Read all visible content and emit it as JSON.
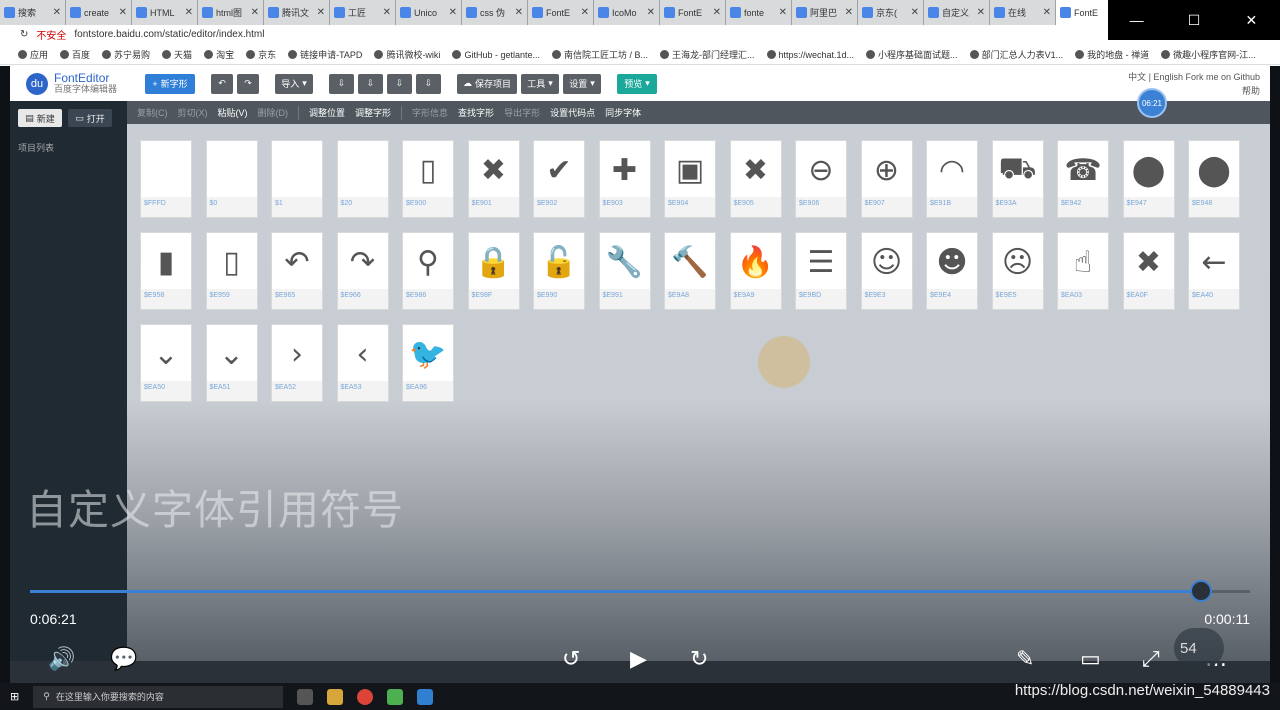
{
  "browser": {
    "tabs": [
      "搜索",
      "create",
      "HTML",
      "html图",
      "腾讯文",
      "工匠",
      "Unico",
      "css 伪",
      "FontE",
      "IcoMo",
      "FontE",
      "fonte",
      "阿里巴",
      "京东(",
      "自定义",
      "在线",
      "FontE"
    ],
    "url": "fontstore.baidu.com/static/editor/index.html",
    "insecure": "不安全",
    "bookmarks": [
      "应用",
      "百度",
      "苏宁易购",
      "天猫",
      "淘宝",
      "京东",
      "链接申请-TAPD",
      "腾讯微校-wiki",
      "GitHub - getlante...",
      "南信院工匠工坊 / B...",
      "王海龙-部门经理汇...",
      "https://wechat.1d...",
      "小程序基础面试题...",
      "部门汇总人力表V1...",
      "我的地盘 - 禅道",
      "微趣小程序官网-江..."
    ]
  },
  "app": {
    "name": "FontEditor",
    "subtitle": "百度字体编辑器",
    "new_glyph": "新字形",
    "import": "导入",
    "save": "保存项目",
    "tools": "工具",
    "settings": "设置",
    "preview": "预览",
    "lang": "中文 | English",
    "github": "Fork me on Github",
    "help": "帮助"
  },
  "sidebar": {
    "new": "新建",
    "open": "打开",
    "list_title": "项目列表"
  },
  "toolbar2": {
    "items": [
      "复制(C)",
      "剪切(X)",
      "粘贴(V)",
      "删除(D)",
      "调整位置",
      "调整字形",
      "字形信息",
      "查找字形",
      "导出字形",
      "设置代码点",
      "同步字体"
    ],
    "disabled": [
      true,
      true,
      false,
      true,
      false,
      false,
      true,
      false,
      true,
      false,
      false
    ]
  },
  "glyphs": [
    [
      {
        "c": "$FFFD",
        "g": ""
      },
      {
        "c": "$0",
        "g": ""
      },
      {
        "c": "$1",
        "g": ""
      },
      {
        "c": "$20",
        "g": ""
      },
      {
        "c": "$E900",
        "g": "▯"
      },
      {
        "c": "$E901",
        "g": "✖"
      },
      {
        "c": "$E902",
        "g": "✔"
      },
      {
        "c": "$E903",
        "g": "✚"
      },
      {
        "c": "$E904",
        "g": "▣"
      },
      {
        "c": "$E905",
        "g": "✖"
      },
      {
        "c": "$E906",
        "g": "⊖"
      },
      {
        "c": "$E907",
        "g": "⊕"
      },
      {
        "c": "$E91B",
        "g": "◠"
      },
      {
        "c": "$E93A",
        "g": "⛟"
      },
      {
        "c": "$E942",
        "g": "☎"
      },
      {
        "c": "$E947",
        "g": "⬤"
      },
      {
        "c": "$E948",
        "g": "⬤"
      }
    ],
    [
      {
        "c": "$E958",
        "g": "▮"
      },
      {
        "c": "$E959",
        "g": "▯"
      },
      {
        "c": "$E965",
        "g": "↶"
      },
      {
        "c": "$E966",
        "g": "↷"
      },
      {
        "c": "$E986",
        "g": "⚲"
      },
      {
        "c": "$E98F",
        "g": "🔒"
      },
      {
        "c": "$E990",
        "g": "🔓"
      },
      {
        "c": "$E991",
        "g": "🔧"
      },
      {
        "c": "$E9A8",
        "g": "🔨"
      },
      {
        "c": "$E9A9",
        "g": "🔥"
      },
      {
        "c": "$E9BD",
        "g": "☰"
      },
      {
        "c": "$E9E3",
        "g": "☺"
      },
      {
        "c": "$E9E4",
        "g": "☻"
      },
      {
        "c": "$E9E5",
        "g": "☹"
      },
      {
        "c": "$EA03",
        "g": "☝"
      },
      {
        "c": "$EA0F",
        "g": "✖"
      },
      {
        "c": "$EA40",
        "g": "←"
      }
    ],
    [
      {
        "c": "$EA50",
        "g": "⌄"
      },
      {
        "c": "$EA51",
        "g": "⌄"
      },
      {
        "c": "$EA52",
        "g": "›"
      },
      {
        "c": "$EA53",
        "g": "‹"
      },
      {
        "c": "$EA96",
        "g": "🐦"
      }
    ]
  ],
  "overlay_title": "自定义字体引用符号",
  "video": {
    "current": "0:06:21",
    "remaining": "0:00:11",
    "badge": "06:21",
    "progress": 0.96,
    "net": "54"
  },
  "taskbar": {
    "search_placeholder": "在这里输入你要搜索的内容"
  },
  "watermark": "https://blog.csdn.net/weixin_54889443",
  "colors": {
    "accent": "#2f7fd8",
    "progress": "#3b7fd4",
    "teal": "#1aa89a"
  }
}
